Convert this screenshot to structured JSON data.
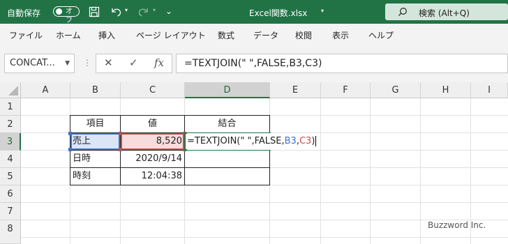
{
  "titlebar": {
    "autosave_label": "自動保存",
    "autosave_toggle": "オフ",
    "filename": "Excel関数.xlsx",
    "search_text": "検索 (Alt+Q)"
  },
  "menu": [
    "ファイル",
    "ホーム",
    "挿入",
    "ページ レイアウト",
    "数式",
    "データ",
    "校閲",
    "表示",
    "ヘルプ"
  ],
  "formula_bar": {
    "name_box": "CONCAT...",
    "formula": "=TEXTJOIN(\" \",FALSE,B3,C3)"
  },
  "grid": {
    "columns": [
      "A",
      "B",
      "C",
      "D",
      "E",
      "F",
      "G",
      "H",
      "I"
    ],
    "rows": [
      "1",
      "2",
      "3",
      "4",
      "5",
      "6",
      "7",
      "8"
    ],
    "cells": {
      "B2": "項目",
      "C2": "値",
      "D2": "結合",
      "B3": "売上",
      "C3": "8,520",
      "B4": "日時",
      "C4": "2020/9/14",
      "B5": "時刻",
      "C5": "12:04:38"
    },
    "edit_formula": {
      "part1": "=TEXTJOIN(\" \",FALSE,",
      "ref1": "B3",
      "comma": ",",
      "ref2": "C3",
      "close": ")"
    }
  },
  "colors": {
    "ref1": "#4472c4",
    "ref2": "#c0504d",
    "accent": "#217346"
  },
  "watermark": "Buzzword Inc."
}
